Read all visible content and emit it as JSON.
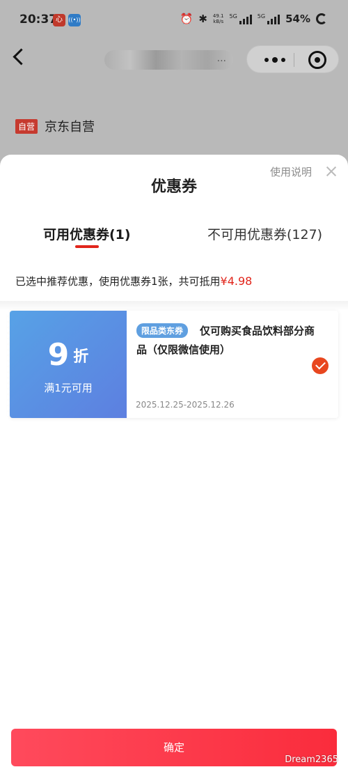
{
  "status_bar": {
    "time": "20:37",
    "app_icon_1": "心",
    "app_icon_2": "((•))",
    "net_speed_top": "49.1",
    "net_speed_unit": "kB/s",
    "signal_1": "5G",
    "signal_2": "5G",
    "battery": "54%",
    "icons": [
      "alarm-icon",
      "bluetooth-icon",
      "signal-icon",
      "battery-icon"
    ]
  },
  "nav": {
    "title_suffix": "...",
    "back_icon": "chevron-left-icon",
    "menu_icon": "more-dots-icon",
    "close_icon": "target-icon"
  },
  "shop": {
    "tag": "自营",
    "name": "京东自营"
  },
  "sheet": {
    "title": "优惠券",
    "usage_link": "使用说明",
    "tabs": [
      {
        "label": "可用优惠券(1)",
        "active": true
      },
      {
        "label": "不可用优惠券(127)",
        "active": false
      }
    ],
    "summary_text": "已选中推荐优惠，使用优惠券1张，共可抵用",
    "summary_amount": "¥4.98"
  },
  "coupons": [
    {
      "discount_value": "9",
      "discount_unit": "折",
      "threshold": "满1元可用",
      "tag": "限品类东券",
      "title": "仅可购买食品饮料部分商品（仅限微信使用）",
      "validity": "2025.12.25-2025.12.26",
      "selected": true
    }
  ],
  "confirm_label": "确定",
  "watermark": "Dream2365",
  "colors": {
    "accent_red": "#e1251b",
    "coupon_blue": "#5d8fe3",
    "check_orange": "#e8471f",
    "button_red": "#fa2c3c"
  }
}
